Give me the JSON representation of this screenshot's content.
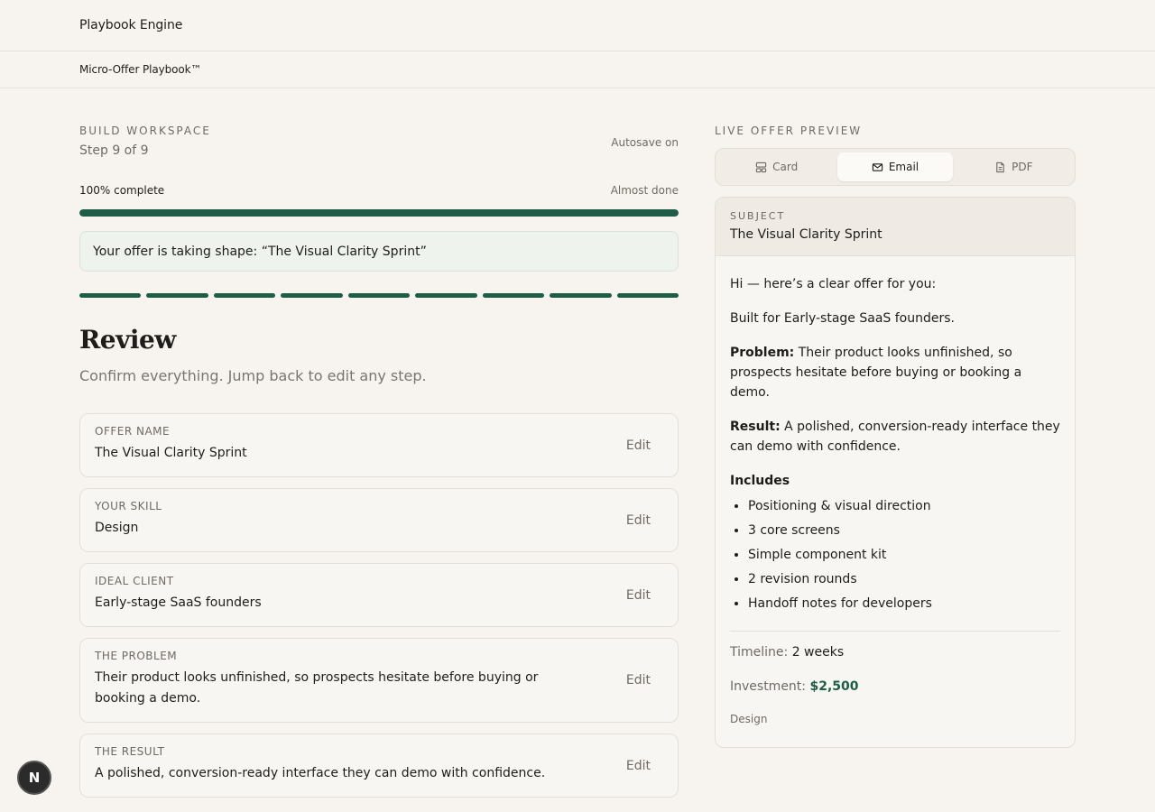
{
  "header": {
    "brand": "Playbook Engine",
    "subtitle": "Micro-Offer Playbook™"
  },
  "workspace": {
    "eyebrow": "BUILD WORKSPACE",
    "step": "Step 9 of 9",
    "autosave": "Autosave on",
    "progress_label": "100% complete",
    "progress_value": 100,
    "progress_status": "Almost done",
    "banner": "Your offer is taking shape: “The Visual Clarity Sprint”",
    "segments_total": 9,
    "segments_done": 9,
    "title": "Review",
    "subtitle": "Confirm everything. Jump back to edit any step."
  },
  "review_items": [
    {
      "label": "OFFER NAME",
      "value": "The Visual Clarity Sprint",
      "edit": "Edit"
    },
    {
      "label": "YOUR SKILL",
      "value": "Design",
      "edit": "Edit"
    },
    {
      "label": "IDEAL CLIENT",
      "value": "Early-stage SaaS founders",
      "edit": "Edit"
    },
    {
      "label": "THE PROBLEM",
      "value": "Their product looks unfinished, so prospects hesitate before buying or booking a demo.",
      "edit": "Edit"
    },
    {
      "label": "THE RESULT",
      "value": "A polished, conversion-ready interface they can demo with confidence.",
      "edit": "Edit"
    }
  ],
  "preview": {
    "eyebrow": "LIVE OFFER PREVIEW",
    "tabs": [
      {
        "label": "Card",
        "icon": "card-icon"
      },
      {
        "label": "Email",
        "icon": "mail-icon"
      },
      {
        "label": "PDF",
        "icon": "document-icon"
      }
    ],
    "active_tab": "Email",
    "subject_label": "SUBJECT",
    "subject": "The Visual Clarity Sprint",
    "greeting": "Hi — here’s a clear offer for you:",
    "built_for": "Built for Early-stage SaaS founders.",
    "problem_label": "Problem:",
    "problem": "Their product looks unfinished, so prospects hesitate before buying or booking a demo.",
    "result_label": "Result:",
    "result": "A polished, conversion-ready interface they can demo with confidence.",
    "includes_label": "Includes",
    "includes": [
      "Positioning & visual direction",
      "3 core screens",
      "Simple component kit",
      "2 revision rounds",
      "Handoff notes for developers"
    ],
    "timeline_label": "Timeline:",
    "timeline": "2 weeks",
    "investment_label": "Investment:",
    "investment": "$2,500",
    "tag": "Design"
  },
  "badge": {
    "letter": "N"
  },
  "colors": {
    "accent": "#1e5d47",
    "background": "#f7f4ef",
    "banner": "#eef3ee"
  }
}
